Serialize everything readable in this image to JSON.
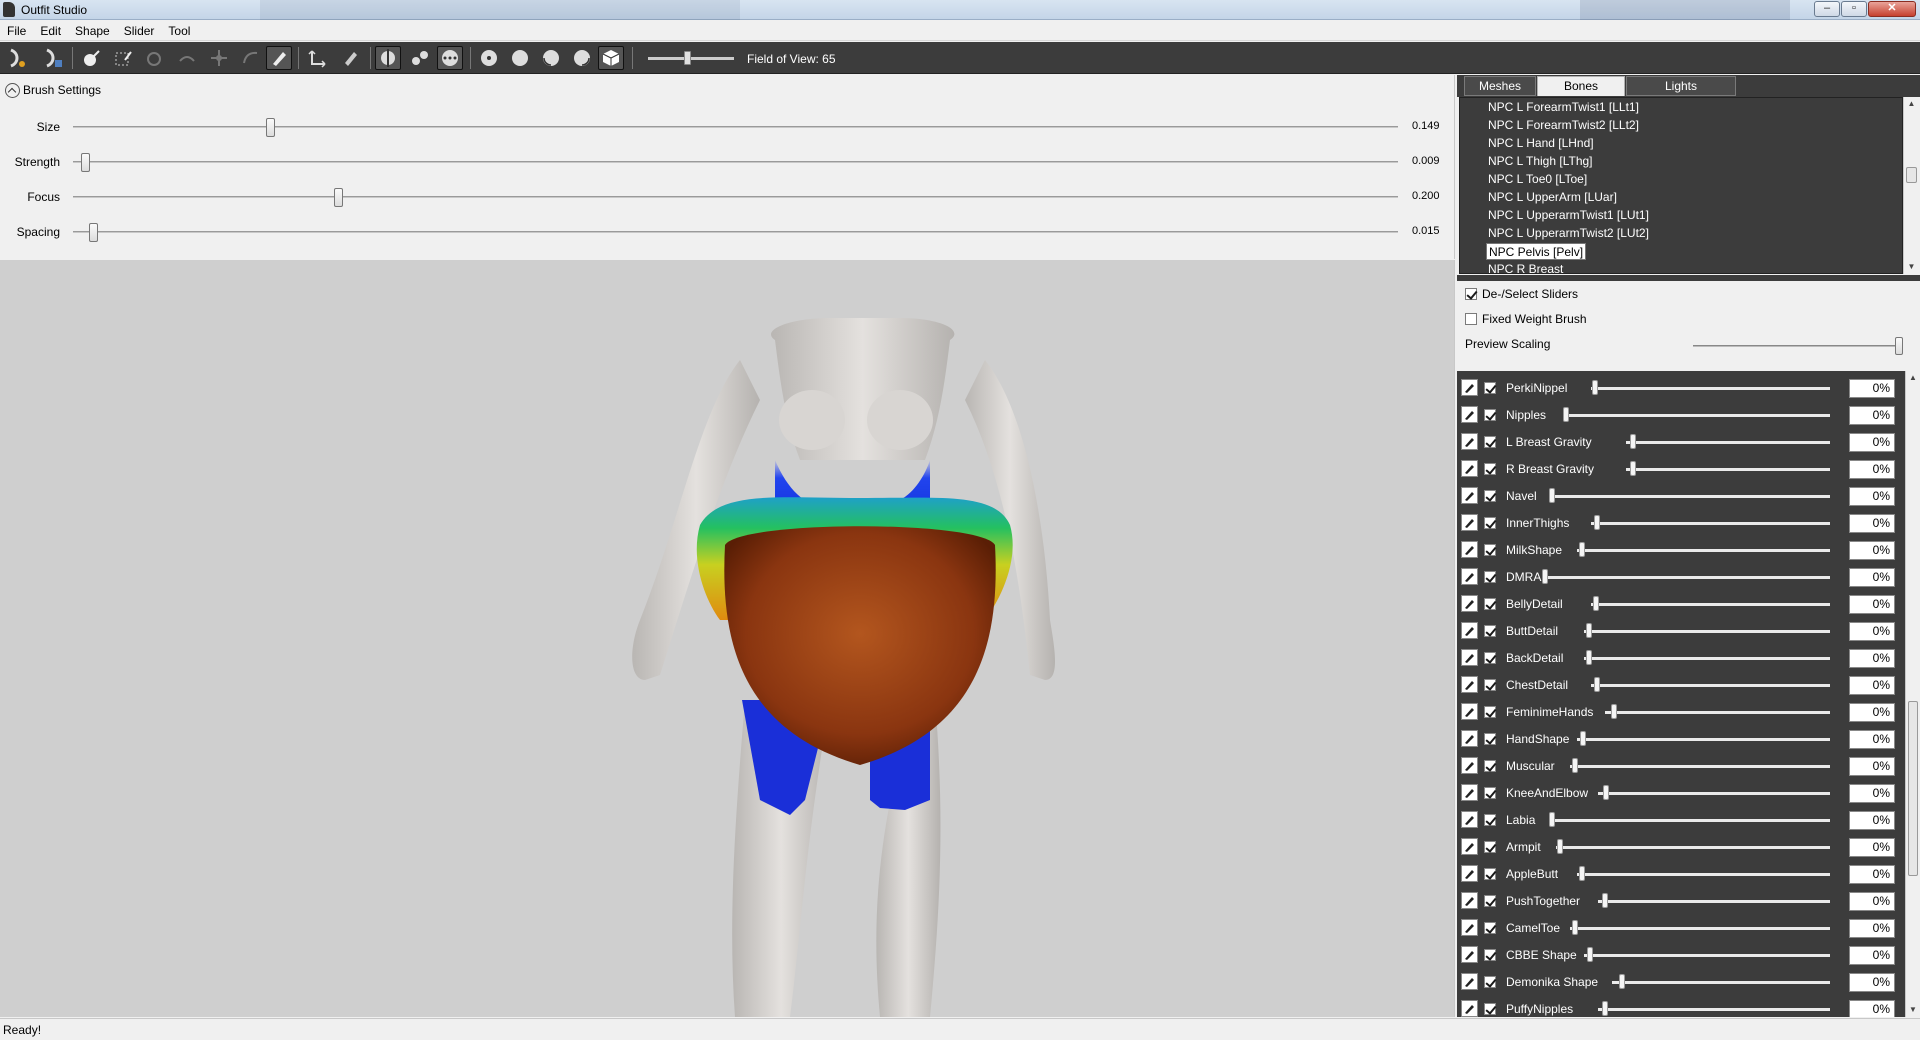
{
  "window": {
    "title": "Outfit Studio"
  },
  "menu": [
    "File",
    "Edit",
    "Shape",
    "Slider",
    "Tool"
  ],
  "toolbar": {
    "fov_label": "Field of View: 65"
  },
  "brush_settings": {
    "header": "Brush Settings",
    "rows": [
      {
        "label": "Size",
        "value": "0.149",
        "level": 0.149
      },
      {
        "label": "Strength",
        "value": "0.009",
        "level": 0.009
      },
      {
        "label": "Focus",
        "value": "0.200",
        "level": 0.2
      },
      {
        "label": "Spacing",
        "value": "0.015",
        "level": 0.015
      }
    ]
  },
  "tabs": [
    "Meshes",
    "Bones",
    "Lights"
  ],
  "bones": [
    "NPC L ForearmTwist1 [LLt1]",
    "NPC L ForearmTwist2 [LLt2]",
    "NPC L Hand [LHnd]",
    "NPC L Thigh [LThg]",
    "NPC L Toe0 [LToe]",
    "NPC L UpperArm [LUar]",
    "NPC L UpperarmTwist1 [LUt1]",
    "NPC L UpperarmTwist2 [LUt2]",
    "NPC Pelvis [Pelv]",
    "NPC R Breast"
  ],
  "selected_bone": "NPC Pelvis [Pelv]",
  "options": {
    "deselect_sliders": "De-/Select Sliders",
    "fixed_weight_brush": "Fixed Weight Brush",
    "preview_scaling": "Preview Scaling"
  },
  "sliders": [
    {
      "name": "PerkiNippel",
      "value": "0%"
    },
    {
      "name": "Nipples",
      "value": "0%"
    },
    {
      "name": "L Breast Gravity",
      "value": "0%"
    },
    {
      "name": "R Breast Gravity",
      "value": "0%"
    },
    {
      "name": "Navel",
      "value": "0%"
    },
    {
      "name": "InnerThighs",
      "value": "0%"
    },
    {
      "name": "MilkShape",
      "value": "0%"
    },
    {
      "name": "DMRA",
      "value": "0%"
    },
    {
      "name": "BellyDetail",
      "value": "0%"
    },
    {
      "name": "ButtDetail",
      "value": "0%"
    },
    {
      "name": "BackDetail",
      "value": "0%"
    },
    {
      "name": "ChestDetail",
      "value": "0%"
    },
    {
      "name": "FeminimeHands",
      "value": "0%"
    },
    {
      "name": "HandShape",
      "value": "0%"
    },
    {
      "name": "Muscular",
      "value": "0%"
    },
    {
      "name": "KneeAndElbow",
      "value": "0%"
    },
    {
      "name": "Labia",
      "value": "0%"
    },
    {
      "name": "Armpit",
      "value": "0%"
    },
    {
      "name": "AppleButt",
      "value": "0%"
    },
    {
      "name": "PushTogether",
      "value": "0%"
    },
    {
      "name": "CamelToe",
      "value": "0%"
    },
    {
      "name": "CBBE Shape",
      "value": "0%"
    },
    {
      "name": "Demonika Shape",
      "value": "0%"
    },
    {
      "name": "PuffyNipples",
      "value": "0%"
    }
  ],
  "status": {
    "text": "Ready!"
  },
  "colors": {
    "toolbar_bg": "#3c3c3c",
    "viewport_bg": "#cfcfcf",
    "panel_bg": "#f0f0f0"
  }
}
